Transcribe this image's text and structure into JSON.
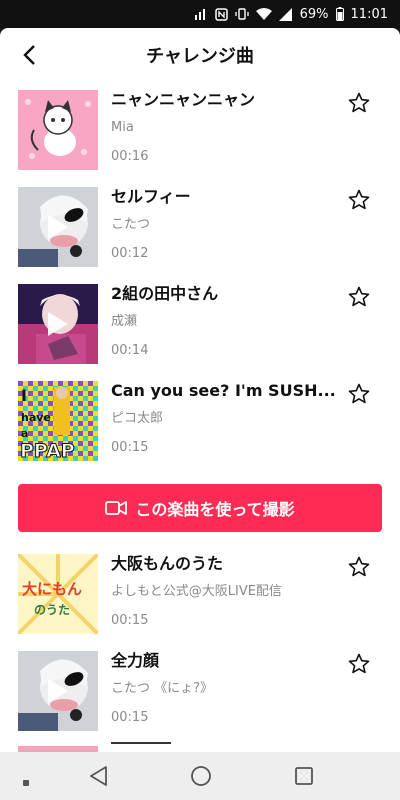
{
  "status_bar": {
    "network_label": "WiFi",
    "battery_text": "69%",
    "time": "11:01"
  },
  "header": {
    "title": "チャレンジ曲",
    "back_icon": "chevron-left-icon"
  },
  "songs": [
    {
      "title": "ニャンニャンニャン",
      "artist": "Mia",
      "duration": "00:16",
      "thumb_color": "#f9a8c8"
    },
    {
      "title": "セルフィー",
      "artist": "こたつ",
      "duration": "00:12",
      "thumb_color": "#c8ccd2"
    },
    {
      "title": "2組の田中さん",
      "artist": "成瀬",
      "duration": "00:14",
      "thumb_color": "#b8428a"
    },
    {
      "title": "Can you see? I'm SUSH...",
      "artist": "ピコ太郎",
      "duration": "00:15",
      "thumb_color": "#6ac259"
    }
  ],
  "shoot_button": {
    "label": "この楽曲を使って撮影",
    "icon": "video-camera-icon",
    "color": "#fe2c55"
  },
  "songs_more": [
    {
      "title": "大阪もんのうた",
      "artist": "よしもと公式@大阪LIVE配信",
      "duration": "00:15",
      "thumb_color": "#fff2b0"
    },
    {
      "title": "全力顔",
      "artist": "こたつ 《にょ?》",
      "duration": "00:15",
      "thumb_color": "#c8ccd2"
    }
  ],
  "thumb_texts": {
    "ppap": [
      "I",
      "have",
      "a",
      "PPAP"
    ],
    "osaka_main": "大にもん",
    "osaka_sub": "のうた"
  },
  "nav_bar": {
    "icons": [
      "recents-dot-icon",
      "back-triangle-icon",
      "home-circle-icon",
      "overview-square-icon"
    ]
  }
}
